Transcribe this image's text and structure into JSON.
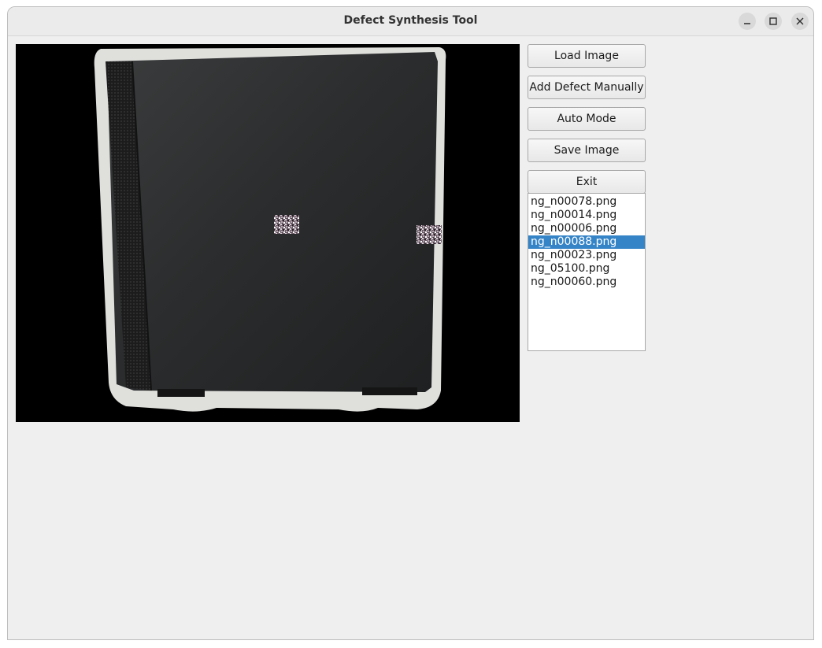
{
  "window": {
    "title": "Defect Synthesis Tool",
    "controls": [
      "minimize-icon",
      "maximize-icon",
      "close-icon"
    ]
  },
  "toolbar": {
    "load_label": "Load Image",
    "add_defect_label": "Add Defect Manually",
    "auto_mode_label": "Auto Mode",
    "save_label": "Save Image",
    "exit_label": "Exit"
  },
  "file_list": {
    "items": [
      "ng_n00078.png",
      "ng_n00014.png",
      "ng_n00006.png",
      "ng_n00088.png",
      "ng_n00023.png",
      "ng_05100.png",
      "ng_n00060.png"
    ],
    "selected": "ng_n00088.png"
  },
  "colors": {
    "selection": "#3584c8",
    "canvas_background": "#000000",
    "window_background": "#efefef"
  }
}
